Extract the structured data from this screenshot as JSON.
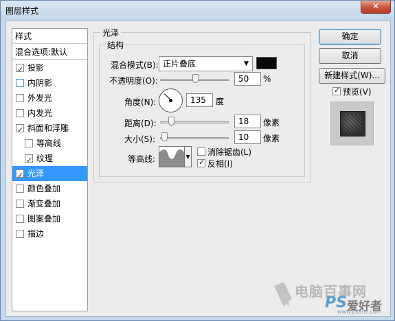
{
  "window": {
    "title": "图层样式",
    "close_glyph": "✕"
  },
  "style_list": {
    "header": "样式",
    "blend_default": "混合选项:默认",
    "items": [
      {
        "label": "投影",
        "checked": true
      },
      {
        "label": "内阴影",
        "checked": false
      },
      {
        "label": "外发光",
        "checked": false
      },
      {
        "label": "内发光",
        "checked": false
      },
      {
        "label": "斜面和浮雕",
        "checked": true
      },
      {
        "label": "等高线",
        "checked": false
      },
      {
        "label": "纹理",
        "checked": true
      },
      {
        "label": "光泽",
        "checked": true,
        "selected": true
      },
      {
        "label": "颜色叠加",
        "checked": false
      },
      {
        "label": "渐变叠加",
        "checked": false
      },
      {
        "label": "图案叠加",
        "checked": false
      },
      {
        "label": "描边",
        "checked": false
      }
    ]
  },
  "satin": {
    "group_title": "光泽",
    "structure_title": "结构",
    "blend_mode_label": "混合模式(B):",
    "blend_mode_value": "正片叠底",
    "blend_color": "#0a0a0a",
    "opacity_label": "不透明度(O):",
    "opacity_value": "50",
    "opacity_unit": "%",
    "angle_label": "角度(N):",
    "angle_value": "135",
    "angle_unit": "度",
    "distance_label": "距离(D):",
    "distance_value": "18",
    "distance_unit": "像素",
    "size_label": "大小(S):",
    "size_value": "10",
    "size_unit": "像素",
    "contour_label": "等高线:",
    "antialias_label": "消除锯齿(L)",
    "antialias_checked": false,
    "invert_label": "反相(I)",
    "invert_checked": true
  },
  "buttons": {
    "ok": "确定",
    "cancel": "取消",
    "new_style": "新建样式(W)...",
    "preview_label": "预览(V)",
    "preview_checked": true
  },
  "watermark": {
    "site_cn": "电脑百事网",
    "brand": "PS",
    "brand_cn": "爱好者",
    "url": "www.psahz.com"
  }
}
